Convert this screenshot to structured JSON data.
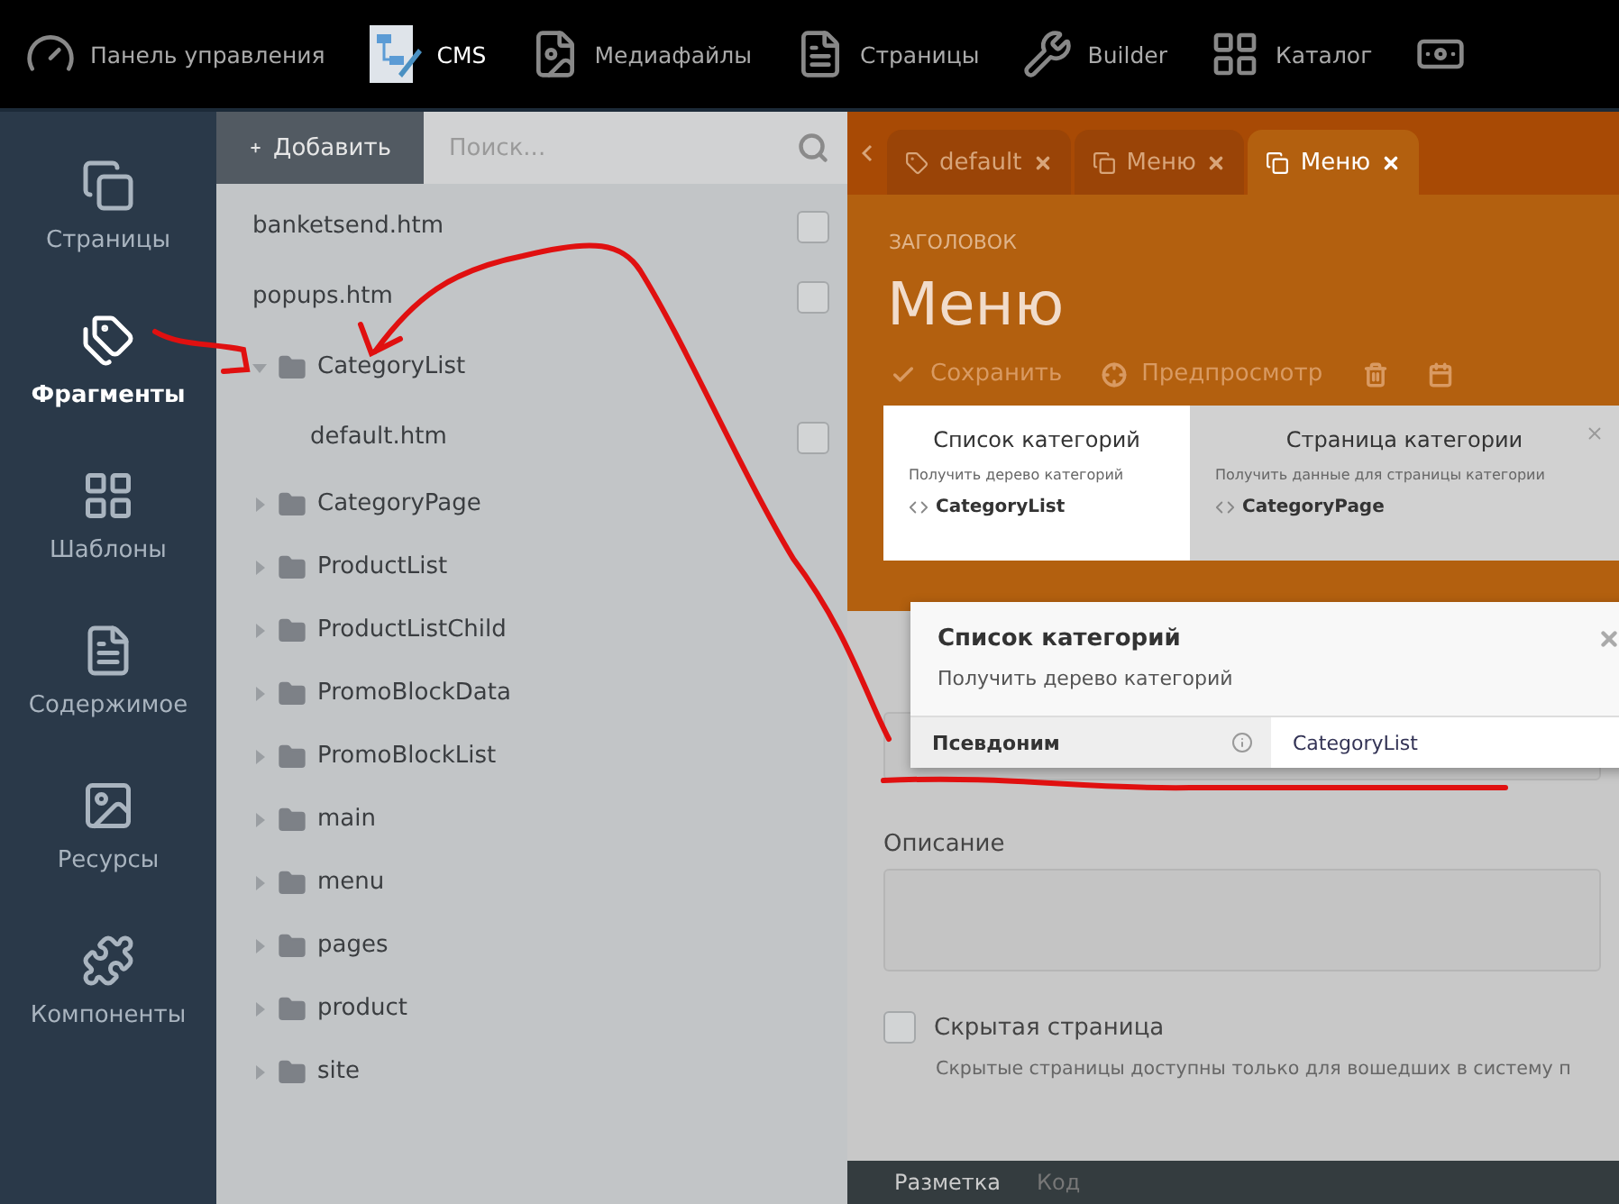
{
  "top_nav": [
    {
      "kind": "gauge",
      "label": "Панель управления",
      "selected": false
    },
    {
      "kind": "cms",
      "label": "CMS",
      "selected": true
    },
    {
      "kind": "media",
      "label": "Медиафайлы",
      "selected": false
    },
    {
      "kind": "pages",
      "label": "Страницы",
      "selected": false
    },
    {
      "kind": "builder",
      "label": "Builder",
      "selected": false
    },
    {
      "kind": "catalog",
      "label": "Каталог",
      "selected": false
    },
    {
      "kind": "money",
      "selected": false
    }
  ],
  "sidebar": [
    {
      "kind": "pages",
      "label": "Страницы",
      "selected": false
    },
    {
      "kind": "partials",
      "label": "Фрагменты",
      "selected": true
    },
    {
      "kind": "layouts",
      "label": "Шаблоны",
      "selected": false
    },
    {
      "kind": "content",
      "label": "Содержимое",
      "selected": false
    },
    {
      "kind": "assets",
      "label": "Ресурсы",
      "selected": false
    },
    {
      "kind": "components",
      "label": "Компоненты",
      "selected": false
    }
  ],
  "tree": {
    "add_button": "Добавить",
    "search": {
      "placeholder": "Поиск..."
    },
    "items": [
      {
        "kind": "file",
        "name": "banketsend.htm",
        "checked": false
      },
      {
        "kind": "file",
        "name": "popups.htm",
        "checked": false
      },
      {
        "kind": "folder",
        "name": "CategoryList",
        "expanded": true,
        "children": [
          {
            "kind": "file",
            "name": "default.htm",
            "checked": false
          }
        ]
      },
      {
        "kind": "folder",
        "name": "CategoryPage",
        "expanded": false
      },
      {
        "kind": "folder",
        "name": "ProductList",
        "expanded": false
      },
      {
        "kind": "folder",
        "name": "ProductListChild",
        "expanded": false
      },
      {
        "kind": "folder",
        "name": "PromoBlockData",
        "expanded": false
      },
      {
        "kind": "folder",
        "name": "PromoBlockList",
        "expanded": false
      },
      {
        "kind": "folder",
        "name": "main",
        "expanded": false
      },
      {
        "kind": "folder",
        "name": "menu",
        "expanded": false
      },
      {
        "kind": "folder",
        "name": "pages",
        "expanded": false
      },
      {
        "kind": "folder",
        "name": "product",
        "expanded": false
      },
      {
        "kind": "folder",
        "name": "site",
        "expanded": false
      }
    ]
  },
  "editor_tabs": [
    {
      "kind": "tag",
      "label": "default",
      "selected": false
    },
    {
      "kind": "copy",
      "label": "Меню",
      "selected": false
    },
    {
      "kind": "copy",
      "label": "Меню",
      "selected": true
    }
  ],
  "header": {
    "caption": "ЗАГОЛОВОК",
    "title": "Меню"
  },
  "toolbar": [
    {
      "kind": "check",
      "label": "Сохранить"
    },
    {
      "kind": "preview",
      "label": "Предпросмотр"
    },
    {
      "kind": "trash"
    },
    {
      "kind": "calendar"
    }
  ],
  "components": [
    {
      "title": "Список категорий",
      "description": "Получить дерево категорий",
      "alias": "CategoryList",
      "selected": true
    },
    {
      "title": "Страница категории",
      "description": "Получить данные для страницы категории",
      "alias": "CategoryPage",
      "selected": false
    }
  ],
  "popover": {
    "title": "Список категорий",
    "description": "Получить дерево категорий",
    "properties": [
      {
        "name": "Псевдоним",
        "value": "CategoryList"
      }
    ]
  },
  "form": {
    "description": {
      "label": "Описание"
    },
    "hidden": {
      "label": "Скрытая страница",
      "checked": false,
      "hint": "Скрытые страницы доступны только для вошедших в систему п"
    }
  },
  "bottom_tabs": [
    {
      "label": "Разметка",
      "selected": true
    },
    {
      "label": "Код",
      "selected": false
    }
  ]
}
